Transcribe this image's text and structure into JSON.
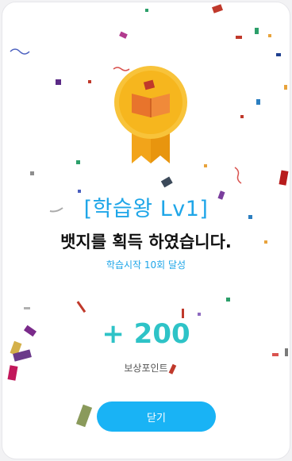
{
  "badge": {
    "title": "[학습왕 Lv1]",
    "message": "뱃지를 획득 하였습니다.",
    "condition": "학습시작 10회 달성",
    "icon": "book-medal-icon"
  },
  "reward": {
    "points": "+ 200",
    "label": "보상포인트"
  },
  "actions": {
    "close_label": "닫기"
  },
  "colors": {
    "accent": "#1fa6e8",
    "points": "#2ec3c7",
    "button": "#19b3f5",
    "medal": "#f6b61e",
    "ribbon": "#f2a41a"
  }
}
